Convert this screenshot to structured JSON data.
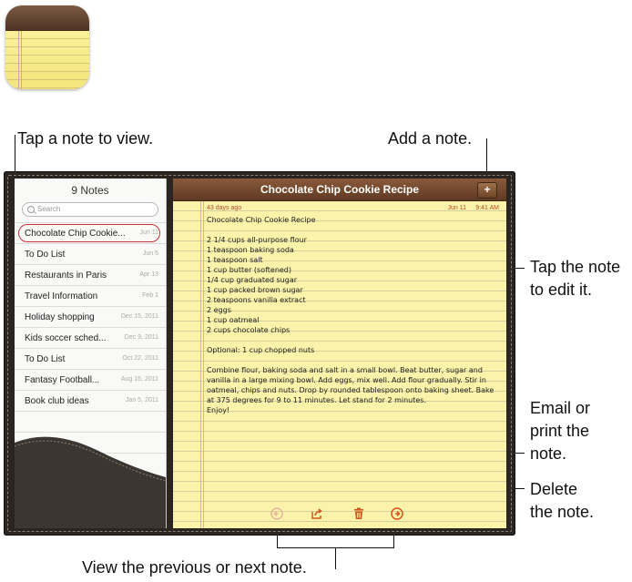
{
  "callouts": {
    "tap_note_view": "Tap a note to view.",
    "add_note": "Add a note.",
    "tap_to_edit": "Tap the note\nto edit it.",
    "email_print": "Email or\nprint the\nnote.",
    "delete_note": "Delete\nthe note.",
    "prev_next": "View the previous or next note."
  },
  "list": {
    "header": "9 Notes",
    "search_placeholder": "Search",
    "items": [
      {
        "title": "Chocolate Chip Cookie...",
        "date": "Jun 11"
      },
      {
        "title": "To Do List",
        "date": "Jun 5"
      },
      {
        "title": "Restaurants in Paris",
        "date": "Apr 13"
      },
      {
        "title": "Travel Information",
        "date": "Feb 1"
      },
      {
        "title": "Holiday shopping",
        "date": "Dec 15, 2011"
      },
      {
        "title": "Kids soccer sched...",
        "date": "Dec 9, 2011"
      },
      {
        "title": "To Do List",
        "date": "Oct 22, 2011"
      },
      {
        "title": "Fantasy Football...",
        "date": "Aug 15, 2011"
      },
      {
        "title": "Book club ideas",
        "date": "Jan 5, 2011"
      }
    ]
  },
  "note": {
    "title": "Chocolate Chip Cookie Recipe",
    "add_label": "+",
    "age": "43 days ago",
    "date": "Jun 11",
    "time": "9:41 AM",
    "body": "Chocolate Chip Cookie Recipe\n\n2 1/4 cups all-purpose flour\n1 teaspoon baking soda\n1 teaspoon salt\n1 cup butter (softened)\n1/4 cup graduated sugar\n1 cup packed brown sugar\n2 teaspoons vanilla extract\n2 eggs\n1 cup oatmeal\n2 cups chocolate chips\n\nOptional: 1 cup chopped nuts\n\nCombine flour, baking soda and salt in a small bowl. Beat butter, sugar and vanilla in a large mixing bowl. Add eggs, mix well. Add flour gradually. Stir in oatmeal, chips and nuts. Drop by rounded tablespoon onto baking sheet. Bake at 375 degrees for 9 to 11 minutes. Let stand for 2 minutes.\nEnjoy!"
  },
  "toolbar": {
    "icons": [
      "previous-arrow-icon",
      "share-icon",
      "trash-icon",
      "next-arrow-icon"
    ]
  },
  "colors": {
    "bar_brown": "#6b4326",
    "paper_yellow": "#fbf3a9",
    "toolbar_orange": "#d2541f",
    "selection_ring": "#cc3333"
  }
}
